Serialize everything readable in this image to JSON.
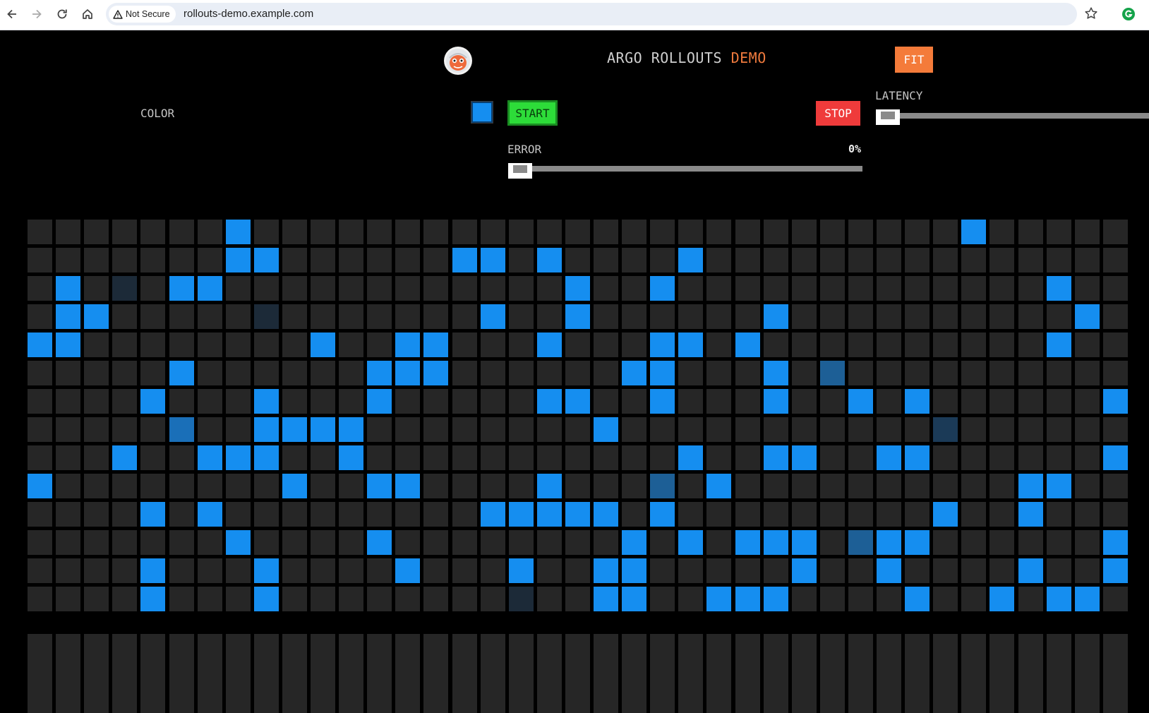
{
  "browser": {
    "security_label": "Not Secure",
    "url": "rollouts-demo.example.com",
    "icons": {
      "back": "back-arrow-icon",
      "forward": "forward-arrow-icon",
      "reload": "reload-icon",
      "home": "home-icon",
      "warning": "warning-triangle-icon",
      "bookmark": "star-icon",
      "extension": "extension-icon"
    }
  },
  "header": {
    "title_main": "ARGO ROLLOUTS",
    "title_accent": "DEMO",
    "fit_label": "FIT",
    "logo_icon": "argo-logo-icon"
  },
  "controls": {
    "color_label": "COLOR",
    "color_value": "#158ef0",
    "start_label": "START",
    "stop_label": "STOP",
    "error_label": "ERROR",
    "error_value": "0%",
    "error_level": 0,
    "latency_label": "LATENCY",
    "latency_level": 0
  },
  "colors": {
    "background": "#000000",
    "cell_empty": "#262626",
    "cell_active": "#158ef0",
    "cell_faded_1": "#1a6fb8",
    "cell_faded_2": "#1d5f96",
    "cell_faded_3": "#1b3a57",
    "cell_faded_4": "#1c2a38",
    "accent_orange": "#f47b3a",
    "start_green": "#2ddc39",
    "stop_red": "#ef3b3b"
  },
  "grid": {
    "columns": 41,
    "rows": 14,
    "legend": ". = empty, B = active blue, d/e/f/g = fading blue (older)",
    "cells": [
      "       B                         B        ",
      "       BB      BB B    B                 B",
      " B g BB            B  B             B   B ",
      " BB     g       B  B      B          B  B ",
      "BB        B  BB   B   BB B          B   BB",
      "     B      BBB      BB   B e             ",
      "    B   B   B     BB  B   B  B B      B B ",
      "     d  BBBB        B           f         ",
      "   B  BBB  B           B  BB  BB      Bd ",
      "B        B  BB    B   e B          BB     ",
      "    B B         BBBBB B         B  B      ",
      "       B    B        B B BBB eBB      B   ",
      "    B   B    B   B  BB     B  B    B  B   ",
      "    B   B        g  BB  BBB    B  B BB   B"
    ],
    "bar_count": 41
  }
}
